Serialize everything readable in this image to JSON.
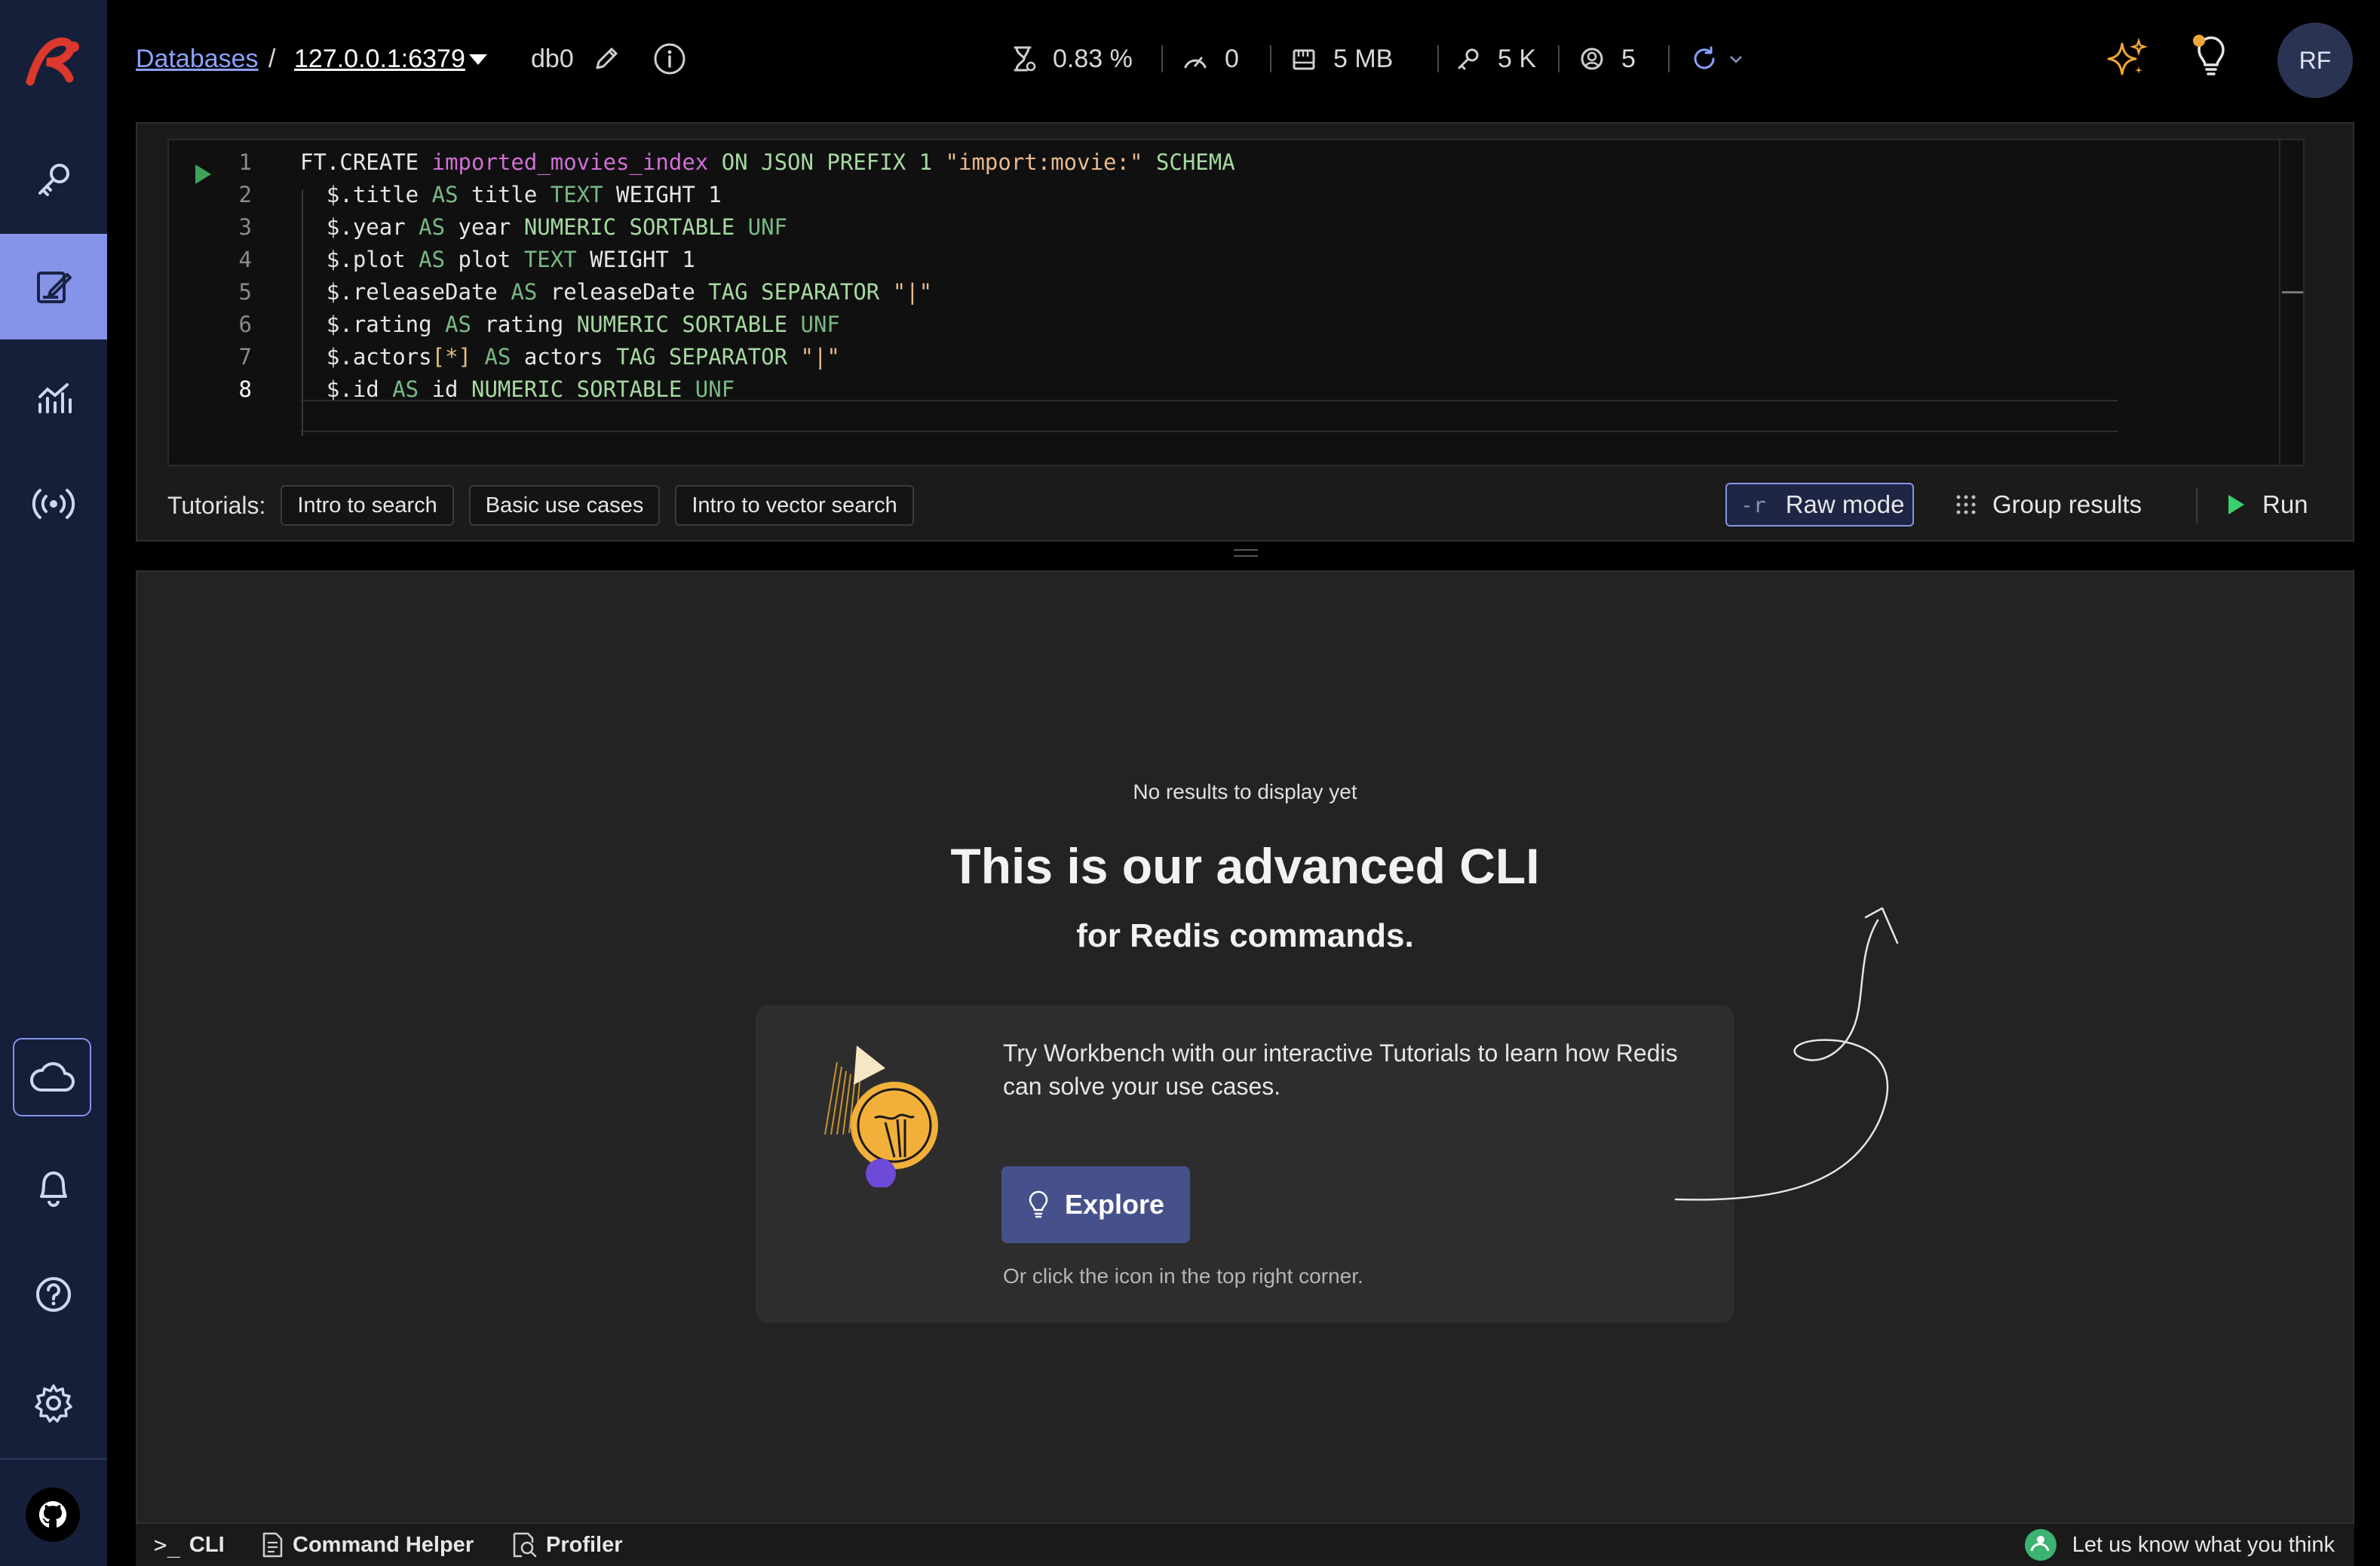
{
  "header": {
    "breadcrumb_root": "Databases",
    "breadcrumb_sep": "/",
    "database_address": "127.0.0.1:6379",
    "db_name": "db0",
    "metrics": {
      "cpu": "0.83 %",
      "ops": "0",
      "memory": "5 MB",
      "keys": "5 K",
      "clients": "5"
    },
    "avatar_initials": "RF"
  },
  "editor": {
    "lines": [
      {
        "number": "1",
        "tokens": [
          {
            "t": "FT.CREATE ",
            "c": "cmd"
          },
          {
            "t": "imported_movies_index",
            "c": "idx"
          },
          {
            "t": " ON JSON PREFIX 1 ",
            "c": "kw"
          },
          {
            "t": "\"import:movie:\"",
            "c": "str"
          },
          {
            "t": " SCHEMA",
            "c": "kw"
          }
        ]
      },
      {
        "number": "2",
        "tokens": [
          {
            "t": "  $.title ",
            "c": "p"
          },
          {
            "t": "AS",
            "c": "dim"
          },
          {
            "t": " title ",
            "c": "p"
          },
          {
            "t": "TEXT",
            "c": "dim"
          },
          {
            "t": " WEIGHT 1",
            "c": "p"
          }
        ]
      },
      {
        "number": "3",
        "tokens": [
          {
            "t": "  $.year ",
            "c": "p"
          },
          {
            "t": "AS",
            "c": "dim"
          },
          {
            "t": " year ",
            "c": "p"
          },
          {
            "t": "NUMERIC SORTABLE ",
            "c": "kw"
          },
          {
            "t": "UNF",
            "c": "dim"
          }
        ]
      },
      {
        "number": "4",
        "tokens": [
          {
            "t": "  $.plot ",
            "c": "p"
          },
          {
            "t": "AS",
            "c": "dim"
          },
          {
            "t": " plot ",
            "c": "p"
          },
          {
            "t": "TEXT",
            "c": "dim"
          },
          {
            "t": " WEIGHT 1",
            "c": "p"
          }
        ]
      },
      {
        "number": "5",
        "tokens": [
          {
            "t": "  $.releaseDate ",
            "c": "p"
          },
          {
            "t": "AS",
            "c": "dim"
          },
          {
            "t": " releaseDate ",
            "c": "p"
          },
          {
            "t": "TAG SEPARATOR ",
            "c": "kw"
          },
          {
            "t": "\"|\"",
            "c": "str"
          }
        ]
      },
      {
        "number": "6",
        "tokens": [
          {
            "t": "  $.rating ",
            "c": "p"
          },
          {
            "t": "AS",
            "c": "dim"
          },
          {
            "t": " rating ",
            "c": "p"
          },
          {
            "t": "NUMERIC SORTABLE ",
            "c": "kw"
          },
          {
            "t": "UNF",
            "c": "dim"
          }
        ]
      },
      {
        "number": "7",
        "tokens": [
          {
            "t": "  $.actors",
            "c": "p"
          },
          {
            "t": "[*]",
            "c": "br"
          },
          {
            "t": " AS",
            "c": "dim"
          },
          {
            "t": " actors ",
            "c": "p"
          },
          {
            "t": "TAG SEPARATOR ",
            "c": "kw"
          },
          {
            "t": "\"|\"",
            "c": "str"
          }
        ]
      },
      {
        "number": "8",
        "tokens": [
          {
            "t": "  $.id ",
            "c": "p"
          },
          {
            "t": "AS",
            "c": "dim"
          },
          {
            "t": " id ",
            "c": "p"
          },
          {
            "t": "NUMERIC SORTABLE ",
            "c": "kw"
          },
          {
            "t": "UNF",
            "c": "dim"
          }
        ]
      }
    ],
    "tutorials_label": "Tutorials:",
    "tutorials": [
      "Intro to search",
      "Basic use cases",
      "Intro to vector search"
    ],
    "raw_mode_flag": "-r",
    "raw_mode_label": "Raw mode",
    "group_results_label": "Group results",
    "run_label": "Run"
  },
  "results": {
    "empty_text": "No results to display yet",
    "title": "This is our advanced CLI",
    "subtitle": "for Redis commands.",
    "card_text": "Try Workbench with our interactive Tutorials to learn how Redis can solve your use cases.",
    "explore_label": "Explore",
    "hint": "Or click the icon in the top right corner."
  },
  "status_bar": {
    "cli": "CLI",
    "cli_prompt": ">_",
    "command_helper": "Command Helper",
    "profiler": "Profiler",
    "feedback": "Let us know what you think"
  },
  "colors": {
    "sidebar_bg": "#161f3a",
    "sidebar_active": "#8594e8",
    "accent": "#8594e8",
    "link": "#8aa1ff",
    "brand_red": "#dc382d",
    "run_green": "#3bd16f",
    "explore_bg": "#46518b"
  }
}
